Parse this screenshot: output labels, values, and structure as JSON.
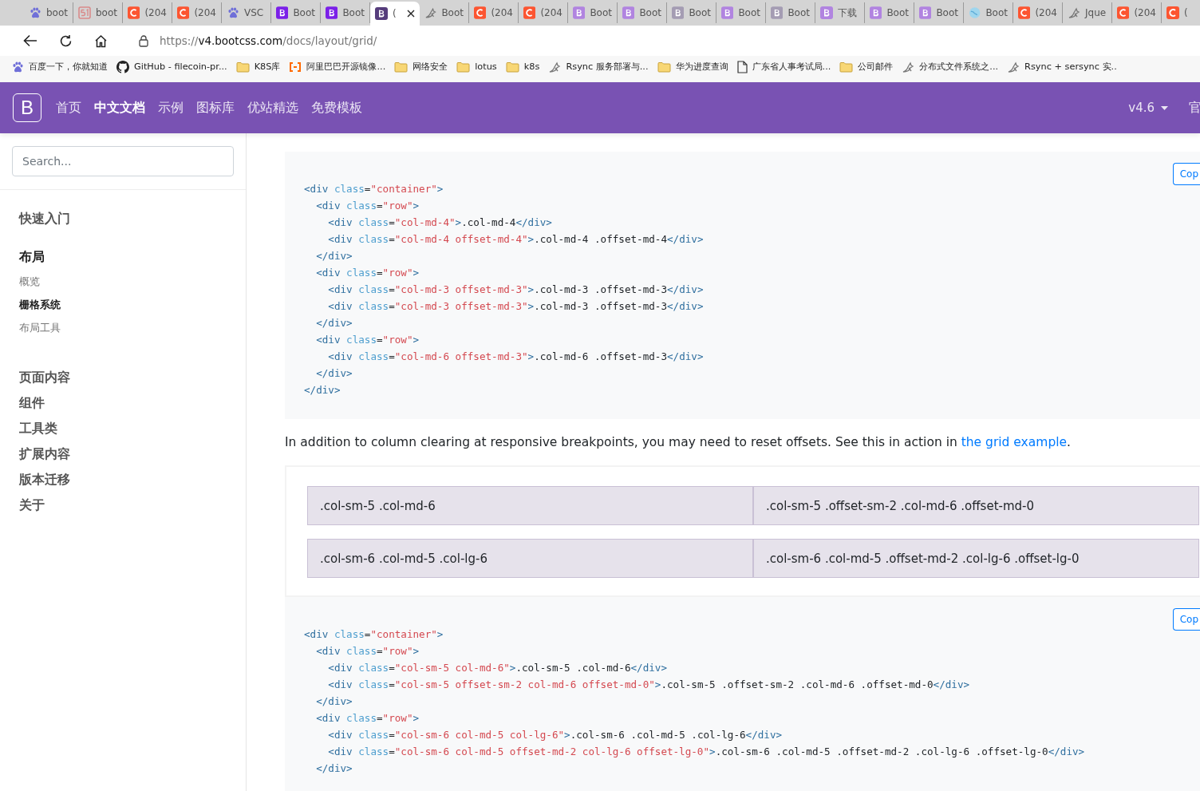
{
  "tabs": [
    {
      "kind": "baidu",
      "title": "boot",
      "selected": false
    },
    {
      "kind": "fiftyone",
      "title": "boot",
      "selected": false
    },
    {
      "kind": "csdn",
      "title": "(204",
      "selected": false
    },
    {
      "kind": "csdn",
      "title": "(204",
      "selected": false
    },
    {
      "kind": "baidu",
      "title": "VSC",
      "selected": false
    },
    {
      "kind": "b",
      "title": "Boot",
      "selected": false
    },
    {
      "kind": "b",
      "title": "Boot",
      "selected": false
    },
    {
      "kind": "bdark",
      "title": "(",
      "selected": true
    },
    {
      "kind": "bird",
      "title": "Boot",
      "selected": false
    },
    {
      "kind": "csdn",
      "title": "(204",
      "selected": false
    },
    {
      "kind": "csdn",
      "title": "(204",
      "selected": false
    },
    {
      "kind": "blight",
      "title": "Boot",
      "selected": false
    },
    {
      "kind": "blight",
      "title": "Boot",
      "selected": false
    },
    {
      "kind": "bgrey",
      "title": "Boot",
      "selected": false
    },
    {
      "kind": "blight",
      "title": "Boot",
      "selected": false
    },
    {
      "kind": "bgrey",
      "title": "Boot",
      "selected": false
    },
    {
      "kind": "blight",
      "title": "下载",
      "selected": false
    },
    {
      "kind": "blight",
      "title": "Boot",
      "selected": false
    },
    {
      "kind": "blight",
      "title": "Boot",
      "selected": false
    },
    {
      "kind": "globe",
      "title": "Boot",
      "selected": false
    },
    {
      "kind": "csdn",
      "title": "(204",
      "selected": false
    },
    {
      "kind": "bird",
      "title": "Jque",
      "selected": false
    },
    {
      "kind": "csdn",
      "title": "(204",
      "selected": false
    },
    {
      "kind": "csdn",
      "title": "(",
      "selected": false
    }
  ],
  "address": {
    "scheme": "https://",
    "host": "v4.bootcss.com",
    "path": "/docs/layout/grid/"
  },
  "bookmarks": [
    {
      "kind": "baidu",
      "label": "百度一下，你就知道"
    },
    {
      "kind": "github",
      "label": "GitHub - filecoin-pr..."
    },
    {
      "kind": "folder",
      "label": "K8S库"
    },
    {
      "kind": "alibaba",
      "label": "阿里巴巴开源镜像..."
    },
    {
      "kind": "folder",
      "label": "网络安全"
    },
    {
      "kind": "folder",
      "label": "lotus"
    },
    {
      "kind": "folder",
      "label": "k8s"
    },
    {
      "kind": "bird",
      "label": "Rsync 服务部署与..."
    },
    {
      "kind": "folder",
      "label": "华为进度查询"
    },
    {
      "kind": "file",
      "label": "广东省人事考试局..."
    },
    {
      "kind": "folder",
      "label": "公司邮件"
    },
    {
      "kind": "bird",
      "label": "分布式文件系统之..."
    },
    {
      "kind": "bird",
      "label": "Rsync + sersync 实.."
    }
  ],
  "navbar": {
    "brand": "B",
    "links": [
      {
        "label": "首页",
        "selected": false
      },
      {
        "label": "中文文档",
        "selected": true
      },
      {
        "label": "示例",
        "selected": false
      },
      {
        "label": "图标库",
        "selected": false
      },
      {
        "label": "优站精选",
        "selected": false
      },
      {
        "label": "免费模板",
        "selected": false
      }
    ],
    "version": "v4.6",
    "cut_link": "官"
  },
  "sidebar": {
    "search": {
      "placeholder": "Search..."
    },
    "sections": [
      {
        "label": "快速入门",
        "active": false
      },
      {
        "label": "布局",
        "active": true,
        "children": [
          {
            "label": "概览",
            "selected": false
          },
          {
            "label": "栅格系统",
            "selected": true
          },
          {
            "label": "布局工具",
            "selected": false
          }
        ]
      },
      {
        "label": "页面内容",
        "active": false
      },
      {
        "label": "组件",
        "active": false
      },
      {
        "label": "工具类",
        "active": false
      },
      {
        "label": "扩展内容",
        "active": false
      },
      {
        "label": "版本迁移",
        "active": false
      },
      {
        "label": "关于",
        "active": false
      }
    ]
  },
  "code_block_1": {
    "copy": "Cop",
    "lines": [
      [
        {
          "kind": "tag",
          "text": "<div"
        },
        {
          "kind": "attr",
          "text": " class"
        },
        {
          "kind": "plain",
          "text": "="
        },
        {
          "kind": "str",
          "text": "\"container\""
        },
        {
          "kind": "tag",
          "text": ">"
        }
      ],
      [
        {
          "kind": "tag",
          "text": "  <div"
        },
        {
          "kind": "attr",
          "text": " class"
        },
        {
          "kind": "plain",
          "text": "="
        },
        {
          "kind": "str",
          "text": "\"row\""
        },
        {
          "kind": "tag",
          "text": ">"
        }
      ],
      [
        {
          "kind": "tag",
          "text": "    <div"
        },
        {
          "kind": "attr",
          "text": " class"
        },
        {
          "kind": "plain",
          "text": "="
        },
        {
          "kind": "str",
          "text": "\"col-md-4\""
        },
        {
          "kind": "tag",
          "text": ">"
        },
        {
          "kind": "plain",
          "text": ".col-md-4"
        },
        {
          "kind": "tag",
          "text": "</div>"
        }
      ],
      [
        {
          "kind": "tag",
          "text": "    <div"
        },
        {
          "kind": "attr",
          "text": " class"
        },
        {
          "kind": "plain",
          "text": "="
        },
        {
          "kind": "str",
          "text": "\"col-md-4 offset-md-4\""
        },
        {
          "kind": "tag",
          "text": ">"
        },
        {
          "kind": "plain",
          "text": ".col-md-4 .offset-md-4"
        },
        {
          "kind": "tag",
          "text": "</div>"
        }
      ],
      [
        {
          "kind": "tag",
          "text": "  </div>"
        }
      ],
      [
        {
          "kind": "tag",
          "text": "  <div"
        },
        {
          "kind": "attr",
          "text": " class"
        },
        {
          "kind": "plain",
          "text": "="
        },
        {
          "kind": "str",
          "text": "\"row\""
        },
        {
          "kind": "tag",
          "text": ">"
        }
      ],
      [
        {
          "kind": "tag",
          "text": "    <div"
        },
        {
          "kind": "attr",
          "text": " class"
        },
        {
          "kind": "plain",
          "text": "="
        },
        {
          "kind": "str",
          "text": "\"col-md-3 offset-md-3\""
        },
        {
          "kind": "tag",
          "text": ">"
        },
        {
          "kind": "plain",
          "text": ".col-md-3 .offset-md-3"
        },
        {
          "kind": "tag",
          "text": "</div>"
        }
      ],
      [
        {
          "kind": "tag",
          "text": "    <div"
        },
        {
          "kind": "attr",
          "text": " class"
        },
        {
          "kind": "plain",
          "text": "="
        },
        {
          "kind": "str",
          "text": "\"col-md-3 offset-md-3\""
        },
        {
          "kind": "tag",
          "text": ">"
        },
        {
          "kind": "plain",
          "text": ".col-md-3 .offset-md-3"
        },
        {
          "kind": "tag",
          "text": "</div>"
        }
      ],
      [
        {
          "kind": "tag",
          "text": "  </div>"
        }
      ],
      [
        {
          "kind": "tag",
          "text": "  <div"
        },
        {
          "kind": "attr",
          "text": " class"
        },
        {
          "kind": "plain",
          "text": "="
        },
        {
          "kind": "str",
          "text": "\"row\""
        },
        {
          "kind": "tag",
          "text": ">"
        }
      ],
      [
        {
          "kind": "tag",
          "text": "    <div"
        },
        {
          "kind": "attr",
          "text": " class"
        },
        {
          "kind": "plain",
          "text": "="
        },
        {
          "kind": "str",
          "text": "\"col-md-6 offset-md-3\""
        },
        {
          "kind": "tag",
          "text": ">"
        },
        {
          "kind": "plain",
          "text": ".col-md-6 .offset-md-3"
        },
        {
          "kind": "tag",
          "text": "</div>"
        }
      ],
      [
        {
          "kind": "tag",
          "text": "  </div>"
        }
      ],
      [
        {
          "kind": "tag",
          "text": "</div>"
        }
      ]
    ]
  },
  "paragraph": {
    "text": "In addition to column clearing at responsive breakpoints, you may need to reset offsets. See this in action in ",
    "link": "the grid example",
    "after": "."
  },
  "example": {
    "rows": [
      [
        ".col-sm-5 .col-md-6",
        ".col-sm-5 .offset-sm-2 .col-md-6 .offset-md-0"
      ],
      [
        ".col-sm-6 .col-md-5 .col-lg-6",
        ".col-sm-6 .col-md-5 .offset-md-2 .col-lg-6 .offset-lg-0"
      ]
    ]
  },
  "code_block_2": {
    "copy": "Cop",
    "lines": [
      [
        {
          "kind": "tag",
          "text": "<div"
        },
        {
          "kind": "attr",
          "text": " class"
        },
        {
          "kind": "plain",
          "text": "="
        },
        {
          "kind": "str",
          "text": "\"container\""
        },
        {
          "kind": "tag",
          "text": ">"
        }
      ],
      [
        {
          "kind": "tag",
          "text": "  <div"
        },
        {
          "kind": "attr",
          "text": " class"
        },
        {
          "kind": "plain",
          "text": "="
        },
        {
          "kind": "str",
          "text": "\"row\""
        },
        {
          "kind": "tag",
          "text": ">"
        }
      ],
      [
        {
          "kind": "tag",
          "text": "    <div"
        },
        {
          "kind": "attr",
          "text": " class"
        },
        {
          "kind": "plain",
          "text": "="
        },
        {
          "kind": "str",
          "text": "\"col-sm-5 col-md-6\""
        },
        {
          "kind": "tag",
          "text": ">"
        },
        {
          "kind": "plain",
          "text": ".col-sm-5 .col-md-6"
        },
        {
          "kind": "tag",
          "text": "</div>"
        }
      ],
      [
        {
          "kind": "tag",
          "text": "    <div"
        },
        {
          "kind": "attr",
          "text": " class"
        },
        {
          "kind": "plain",
          "text": "="
        },
        {
          "kind": "str",
          "text": "\"col-sm-5 offset-sm-2 col-md-6 offset-md-0\""
        },
        {
          "kind": "tag",
          "text": ">"
        },
        {
          "kind": "plain",
          "text": ".col-sm-5 .offset-sm-2 .col-md-6 .offset-md-0"
        },
        {
          "kind": "tag",
          "text": "</div>"
        }
      ],
      [
        {
          "kind": "tag",
          "text": "  </div>"
        }
      ],
      [
        {
          "kind": "tag",
          "text": "  <div"
        },
        {
          "kind": "attr",
          "text": " class"
        },
        {
          "kind": "plain",
          "text": "="
        },
        {
          "kind": "str",
          "text": "\"row\""
        },
        {
          "kind": "tag",
          "text": ">"
        }
      ],
      [
        {
          "kind": "tag",
          "text": "    <div"
        },
        {
          "kind": "attr",
          "text": " class"
        },
        {
          "kind": "plain",
          "text": "="
        },
        {
          "kind": "str",
          "text": "\"col-sm-6 col-md-5 col-lg-6\""
        },
        {
          "kind": "tag",
          "text": ">"
        },
        {
          "kind": "plain",
          "text": ".col-sm-6 .col-md-5 .col-lg-6"
        },
        {
          "kind": "tag",
          "text": "</div>"
        }
      ],
      [
        {
          "kind": "tag",
          "text": "    <div"
        },
        {
          "kind": "attr",
          "text": " class"
        },
        {
          "kind": "plain",
          "text": "="
        },
        {
          "kind": "str",
          "text": "\"col-sm-6 col-md-5 offset-md-2 col-lg-6 offset-lg-0\""
        },
        {
          "kind": "tag",
          "text": ">"
        },
        {
          "kind": "plain",
          "text": ".col-sm-6 .col-md-5 .offset-md-2 .col-lg-6 .offset-lg-0"
        },
        {
          "kind": "tag",
          "text": "</div>"
        }
      ],
      [
        {
          "kind": "tag",
          "text": "  </div>"
        }
      ]
    ]
  }
}
